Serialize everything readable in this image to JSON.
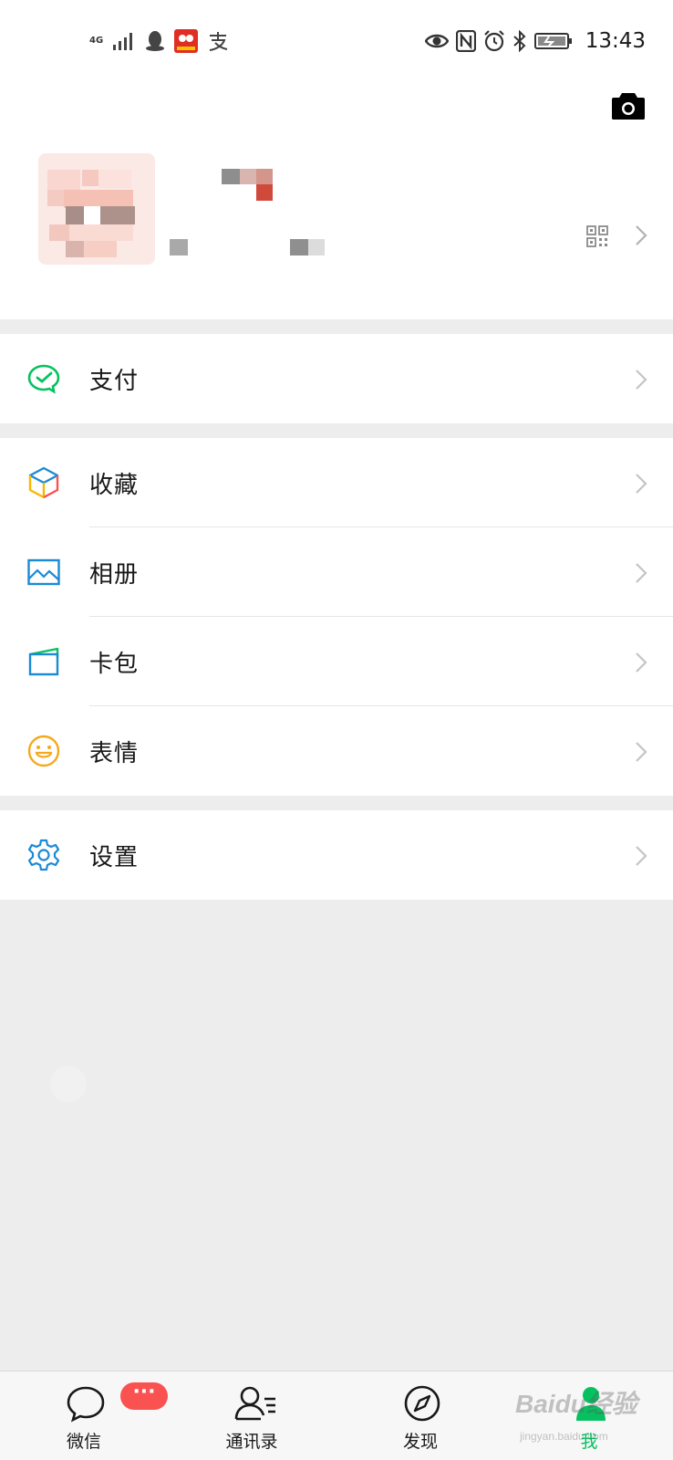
{
  "status_bar": {
    "network": "4G",
    "time": "13:43",
    "icons": [
      "signal-icon",
      "qq-icon",
      "taobao-icon",
      "alipay-icon",
      "eye-icon",
      "nfc-icon",
      "alarm-icon",
      "bluetooth-icon",
      "battery-icon"
    ]
  },
  "profile": {
    "camera_icon": "camera-icon",
    "qr_icon": "qr-code-icon"
  },
  "menu": {
    "pay": {
      "label": "支付",
      "icon": "wechat-pay-icon"
    },
    "favorites": {
      "label": "收藏",
      "icon": "cube-icon"
    },
    "album": {
      "label": "相册",
      "icon": "image-icon"
    },
    "cards": {
      "label": "卡包",
      "icon": "wallet-icon"
    },
    "stickers": {
      "label": "表情",
      "icon": "smiley-icon"
    },
    "settings": {
      "label": "设置",
      "icon": "gear-icon"
    }
  },
  "tabs": [
    {
      "label": "微信",
      "icon": "chat-icon",
      "badge": "···"
    },
    {
      "label": "通讯录",
      "icon": "contacts-icon"
    },
    {
      "label": "发现",
      "icon": "compass-icon"
    },
    {
      "label": "我",
      "icon": "person-icon",
      "active": true
    }
  ],
  "watermark": {
    "text": "Baidu经验",
    "sub": "jingyan.baidu.com"
  },
  "colors": {
    "accent": "#07c160",
    "badge": "#fa5151",
    "background": "#ededed",
    "icon_blue": "#1b8ad6"
  }
}
